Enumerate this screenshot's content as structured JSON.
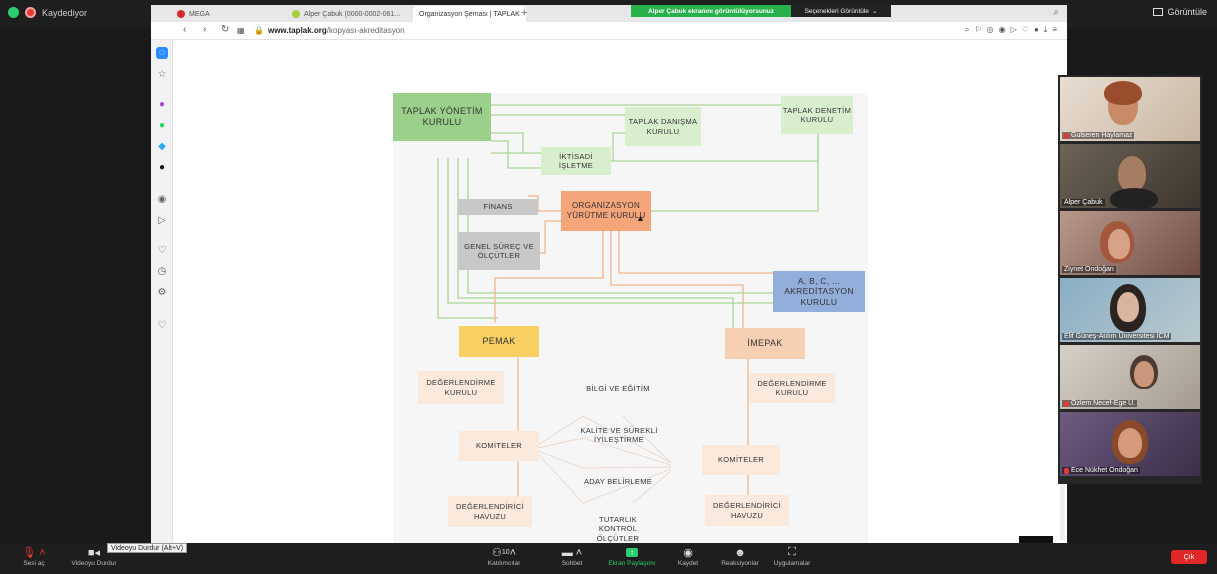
{
  "zoom": {
    "recording_label": "Kaydediyor",
    "view_label": "Görüntüle",
    "share_banner": "Alper Çabuk ekranını görüntülüyorsunuz",
    "view_options": "Seçenekleri Görüntüle",
    "tooltip": "Videoyu Durdur (Alt+V)",
    "leave_label": "Çık",
    "toolbar": [
      {
        "icon": "mic-off-icon",
        "label": "Sesi aç"
      },
      {
        "icon": "video-icon",
        "label": "Videoyu Durdur"
      },
      {
        "icon": "participants-icon",
        "label": "Katılımcılar",
        "count": "10"
      },
      {
        "icon": "chat-icon",
        "label": "Sohbet"
      },
      {
        "icon": "share-screen-icon",
        "label": "Ekran Paylaşımı"
      },
      {
        "icon": "record-icon",
        "label": "Kaydet"
      },
      {
        "icon": "reactions-icon",
        "label": "Reaksiyonlar"
      },
      {
        "icon": "apps-icon",
        "label": "Uygulamalar"
      }
    ],
    "participants": [
      {
        "name": "Gulseren Haylamaz",
        "muted": true
      },
      {
        "name": "Alper Çabuk",
        "muted": false
      },
      {
        "name": "Ziynet Ondoğan",
        "muted": false
      },
      {
        "name": "Elif Güneş-Atılım Üniversitesi ICM",
        "muted": false
      },
      {
        "name": "Özlem Necef-Ege U.",
        "muted": true
      },
      {
        "name": "Ece Nükhet Ondoğan",
        "muted": true
      }
    ]
  },
  "browser": {
    "tabs": [
      {
        "label": "MEGA",
        "active": false
      },
      {
        "label": "Alper Çabuk (0000-0002-061...",
        "active": false
      },
      {
        "label": "Organizasyon Şeması | TAPLAK",
        "active": true
      }
    ],
    "url_domain": "www.taplak.org",
    "url_path": "/kopyası-akreditasyon"
  },
  "org_chart": {
    "boxes": {
      "yonetim": "TAPLAK YÖNETİM KURULU",
      "danisma": "TAPLAK DANIŞMA KURULU",
      "denetim": "TAPLAK DENETİM KURULU",
      "iktisadi": "İKTİSADİ İŞLETME",
      "finans": "FİNANS",
      "yurutme": "ORGANİZASYON YÜRÜTME KURULU",
      "genel_surec": "GENEL SÜREÇ VE ÖLÇÜTLER",
      "akreditasyon": "A, B, C, ... AKREDİTASYON KURULU",
      "pemak": "PEMAK",
      "imepak": "İMEPAK",
      "pemak_degerlendirme": "DEĞERLENDİRME KURULU",
      "imepak_degerlendirme": "DEĞERLENDİRME KURULU",
      "pemak_komiteler": "KOMİTELER",
      "imepak_komiteler": "KOMİTELER",
      "pemak_havuz": "DEĞERLENDİRİCİ HAVUZU",
      "imepak_havuz": "DEĞERLENDİRİCİ HAVUZU",
      "bilgi": "BİLGİ VE EĞİTİM",
      "kalite": "KALİTE VE SÜREKLİ İYİLEŞTİRME",
      "aday": "ADAY BELİRLEME",
      "tutarlik": "TUTARLIK KONTROL ÖLÇÜTLER"
    },
    "colors": {
      "green": "#9bd08a",
      "orange": "#f4a57a",
      "gray": "#c8c8c8",
      "blue": "#93aedb",
      "yellow": "#f7cf62",
      "peach": "#f7cfb3",
      "light_peach": "#fbe9dc",
      "line_green": "#a8d596",
      "line_orange": "#f2b488"
    }
  }
}
